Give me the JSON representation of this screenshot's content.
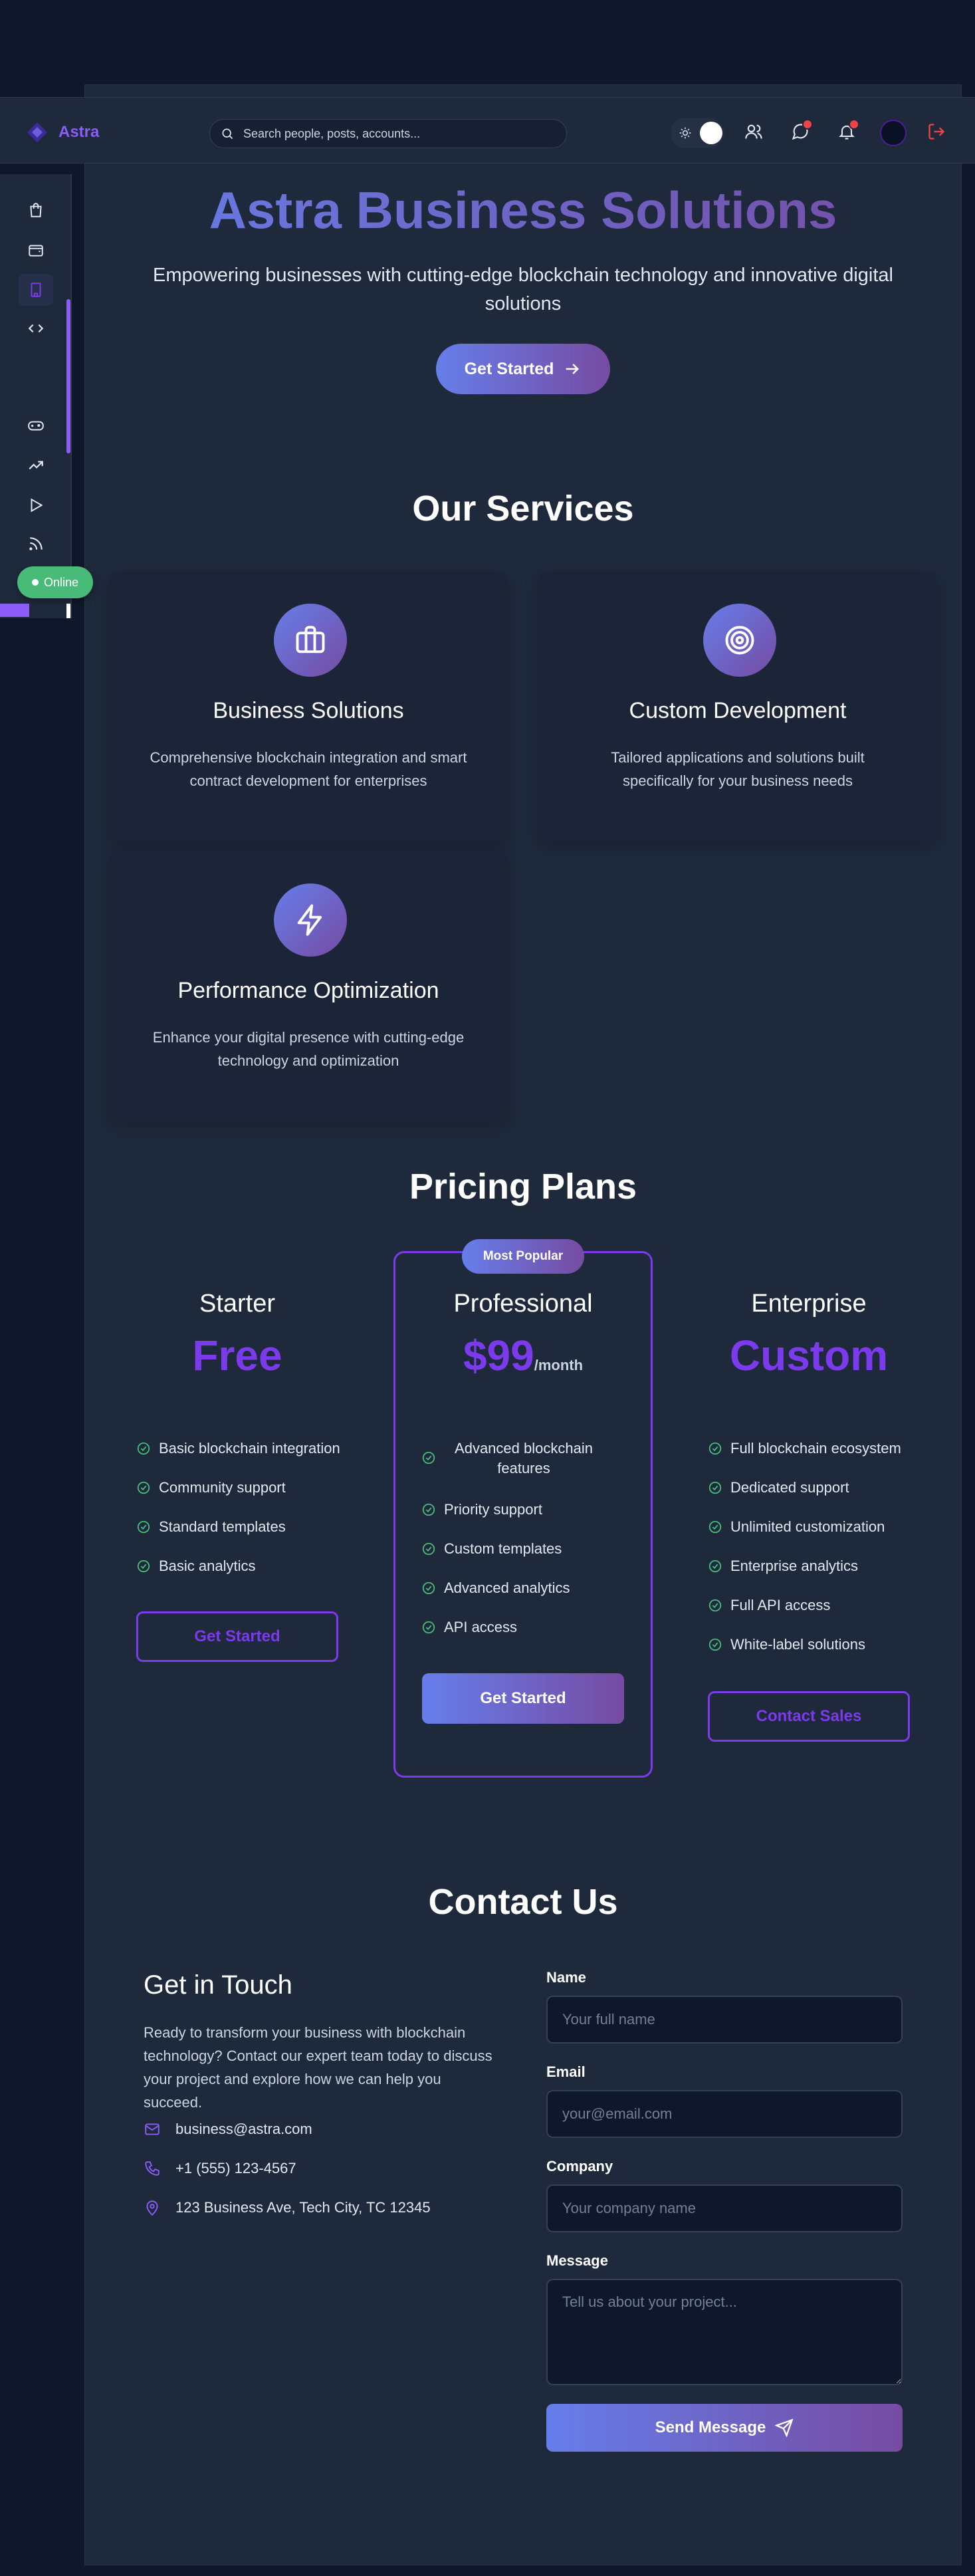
{
  "brand": {
    "name": "Astra"
  },
  "search": {
    "placeholder": "Search people, posts, accounts..."
  },
  "status": {
    "online_label": "Online"
  },
  "hero": {
    "title": "Astra Business Solutions",
    "subtitle": "Empowering businesses with cutting-edge blockchain technology and innovative digital solutions",
    "cta_label": "Get Started"
  },
  "services": {
    "title": "Our Services",
    "items": [
      {
        "icon": "briefcase-icon",
        "title": "Business Solutions",
        "description": "Comprehensive blockchain integration and smart contract development for enterprises"
      },
      {
        "icon": "target-icon",
        "title": "Custom Development",
        "description": "Tailored applications and solutions built specifically for your business needs"
      },
      {
        "icon": "lightning-icon",
        "title": "Performance Optimization",
        "description": "Enhance your digital presence with cutting-edge technology and optimization"
      }
    ]
  },
  "pricing": {
    "title": "Pricing Plans",
    "popular_badge": "Most Popular",
    "plans": [
      {
        "name": "Starter",
        "price": "Free",
        "period": "",
        "features": [
          "Basic blockchain integration",
          "Community support",
          "Standard templates",
          "Basic analytics"
        ],
        "cta": "Get Started"
      },
      {
        "name": "Professional",
        "price": "$99",
        "period": "/month",
        "features": [
          "Advanced blockchain features",
          "Priority support",
          "Custom templates",
          "Advanced analytics",
          "API access"
        ],
        "cta": "Get Started"
      },
      {
        "name": "Enterprise",
        "price": "Custom",
        "period": "",
        "features": [
          "Full blockchain ecosystem",
          "Dedicated support",
          "Unlimited customization",
          "Enterprise analytics",
          "Full API access",
          "White-label solutions"
        ],
        "cta": "Contact Sales"
      }
    ]
  },
  "contact": {
    "title": "Contact Us",
    "heading": "Get in Touch",
    "text": "Ready to transform your business with blockchain technology? Contact our expert team today to discuss your project and explore how we can help you succeed.",
    "email": "business@astra.com",
    "phone": "+1 (555) 123-4567",
    "address": "123 Business Ave, Tech City, TC 12345",
    "form": {
      "name_label": "Name",
      "name_placeholder": "Your full name",
      "email_label": "Email",
      "email_placeholder": "your@email.com",
      "company_label": "Company",
      "company_placeholder": "Your company name",
      "message_label": "Message",
      "message_placeholder": "Tell us about your project...",
      "submit_label": "Send Message"
    }
  },
  "colors": {
    "accent": "#7c3aed",
    "gradient_start": "#667eea",
    "gradient_end": "#764ba2",
    "online": "#48bb78",
    "danger": "#ef4444",
    "success": "#48bb78"
  }
}
